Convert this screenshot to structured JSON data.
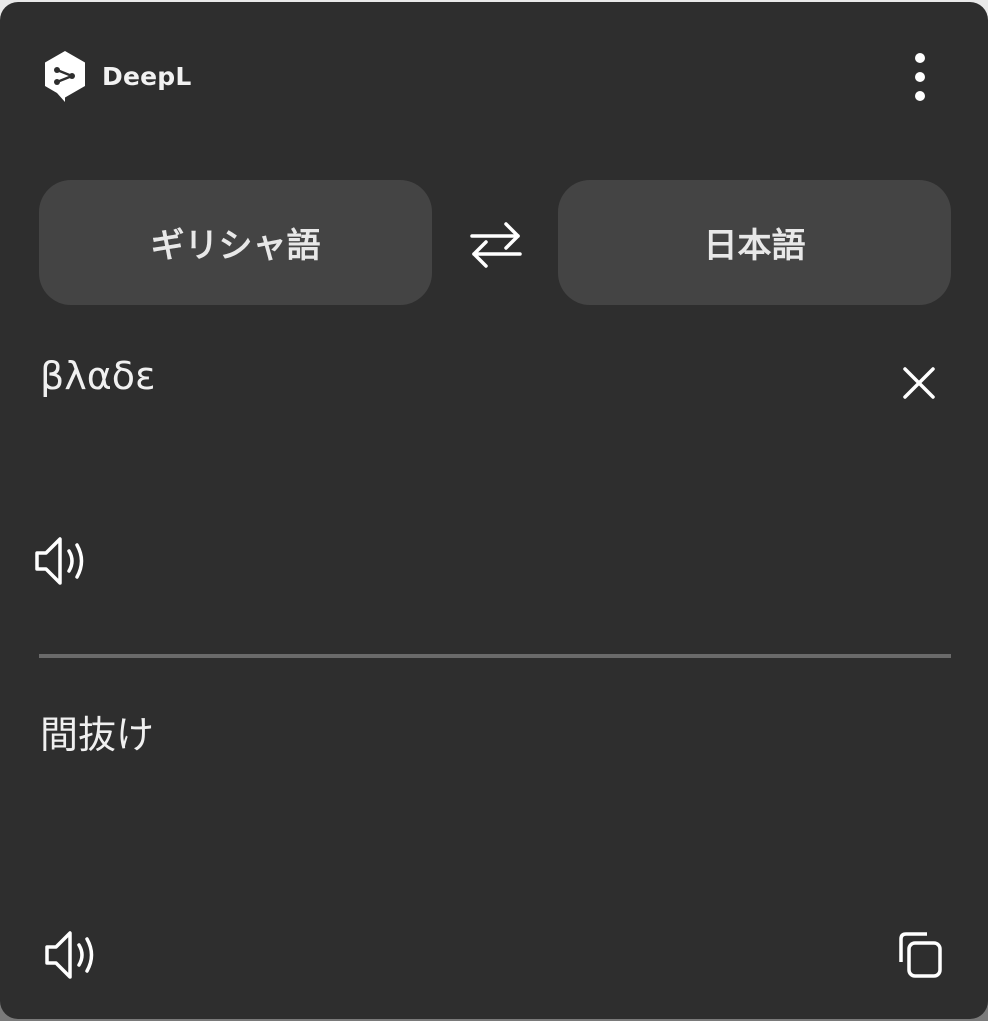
{
  "app": {
    "brand": "DeepL",
    "accent_color": "#ffffff",
    "background_color": "#2e2e2e",
    "button_color": "#444444"
  },
  "header": {
    "logo_icon": "deepl-logo-icon",
    "menu_icon": "more-vertical-icon"
  },
  "languages": {
    "source": "ギリシャ語",
    "target": "日本語",
    "swap_icon": "swap-arrows-icon"
  },
  "source": {
    "text": "βλαδε",
    "clear_icon": "close-icon",
    "speak_icon": "speaker-icon"
  },
  "translation": {
    "text": "間抜け",
    "speak_icon": "speaker-icon",
    "copy_icon": "copy-icon"
  }
}
